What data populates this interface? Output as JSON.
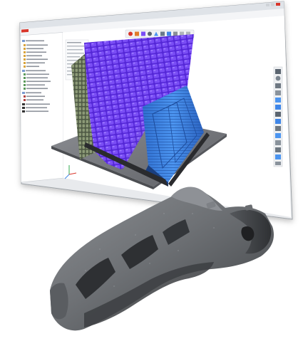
{
  "window": {
    "title": "",
    "brand_color": "#d9362b"
  },
  "toolbar": {
    "icons": [
      "home-icon",
      "cube-icon",
      "layers-icon",
      "settings-icon",
      "support-icon",
      "view-icon",
      "slice-icon",
      "export-icon"
    ]
  },
  "tree_panel": {
    "items": [
      "",
      "",
      "",
      "",
      "",
      "",
      "",
      "",
      "",
      "",
      "",
      "",
      "",
      "",
      "",
      "",
      "",
      "",
      "",
      "",
      "",
      "",
      ""
    ]
  },
  "right_toolbar": {
    "icons": [
      "select-icon",
      "zoom-icon",
      "rotate-icon",
      "pan-icon",
      "fit-icon",
      "front-view-icon",
      "top-view-icon",
      "iso-view-icon",
      "measure-icon",
      "section-icon",
      "light-icon",
      "camera-icon",
      "grid-icon",
      "info-icon"
    ]
  },
  "viewport": {
    "part_color_purple": "#6a3dea",
    "part_color_blue": "#3f86e8",
    "platform_color": "#7d7f85",
    "axis_labels": [
      "z",
      "x",
      "y"
    ]
  },
  "photo": {
    "part_color": "#6e7175"
  }
}
